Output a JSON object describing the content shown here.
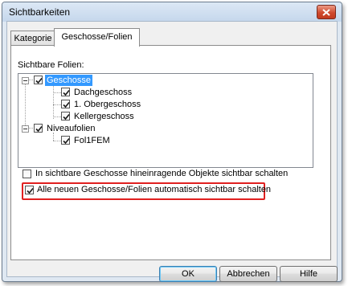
{
  "window": {
    "title": "Sichtbarkeiten"
  },
  "tabs": [
    {
      "label": "Kategorie",
      "active": false
    },
    {
      "label": "Geschosse/Folien",
      "active": true
    }
  ],
  "panel": {
    "label": "Sichtbare Folien:",
    "tree": [
      {
        "label": "Geschosse",
        "checked": true,
        "expanded": true,
        "selected": true,
        "level": 0
      },
      {
        "label": "Dachgeschoss",
        "checked": true,
        "level": 1
      },
      {
        "label": "1. Obergeschoss",
        "checked": true,
        "level": 1
      },
      {
        "label": "Kellergeschoss",
        "checked": true,
        "level": 1
      },
      {
        "label": "Niveaufolien",
        "checked": true,
        "expanded": true,
        "level": 0
      },
      {
        "label": "Fol1FEM",
        "checked": true,
        "level": 1
      }
    ]
  },
  "options": {
    "option1": {
      "label": "In sichtbare Geschosse hineinragende Objekte sichtbar schalten",
      "checked": false
    },
    "option2": {
      "label": "Alle neuen Geschosse/Folien automatisch sichtbar schalten",
      "checked": true,
      "highlight_color": "#e02020"
    }
  },
  "buttons": {
    "ok": "OK",
    "cancel": "Abbrechen",
    "help": "Hilfe"
  },
  "colors": {
    "selection": "#3399ff",
    "close_button": "#cf4a2e"
  },
  "icons": {
    "close": "close-icon",
    "check": "checkmark-icon"
  }
}
